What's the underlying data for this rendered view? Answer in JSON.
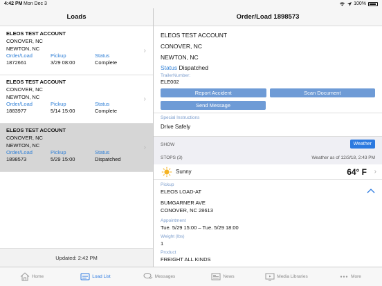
{
  "status_bar": {
    "time": "4:42 PM",
    "date": "Mon Dec 3",
    "battery": "100%"
  },
  "left_header": {
    "title": "Loads"
  },
  "right_header": {
    "title": "Order/Load 1898573"
  },
  "loads": [
    {
      "account": "ELEOS TEST ACCOUNT",
      "city1": "CONOVER, NC",
      "city2": "NEWTON, NC",
      "order_label": "Order/Load",
      "order": "1872661",
      "pickup_label": "Pickup",
      "pickup": "3/29 08:00",
      "status_label": "Status",
      "status": "Complete",
      "selected": false
    },
    {
      "account": "ELEOS TEST ACCOUNT",
      "city1": "CONOVER, NC",
      "city2": "NEWTON, NC",
      "order_label": "Order/Load",
      "order": "1883977",
      "pickup_label": "Pickup",
      "pickup": "5/14 15:00",
      "status_label": "Status",
      "status": "Complete",
      "selected": false
    },
    {
      "account": "ELEOS TEST ACCOUNT",
      "city1": "CONOVER, NC",
      "city2": "NEWTON, NC",
      "order_label": "Order/Load",
      "order": "1898573",
      "pickup_label": "Pickup",
      "pickup": "5/29 15:00",
      "status_label": "Status",
      "status": "Dispatched",
      "selected": true
    }
  ],
  "updated": "Updated: 2:42 PM",
  "detail": {
    "account": "ELEOS TEST ACCOUNT",
    "city1": "CONOVER, NC",
    "city2": "NEWTON, NC",
    "status_label": "Status",
    "status": "Dispatched",
    "trailer_label": "TrailerNumber:",
    "trailer": "ELE002",
    "buttons": {
      "report": "Report Accident",
      "scan": "Scan Document",
      "message": "Send Message"
    },
    "special_label": "Special Instructions",
    "special": "Drive Safely",
    "show_label": "SHOW",
    "weather_button": "Weather",
    "stops_label": "STOPS (3)",
    "weather_as_of": "Weather as of 12/3/18, 2:43 PM",
    "weather_cond": "Sunny",
    "weather_temp": "64° F",
    "stop": {
      "pickup_label": "Pickup",
      "name": "ELEOS LOAD-AT",
      "street": "BUMGARNER AVE",
      "city": "CONOVER, NC 28613",
      "appt_label": "Appointment",
      "appt": "Tue. 5/29 15:00 – Tue. 5/29 18:00",
      "weight_label": "Weight (lbs)",
      "weight": "1",
      "product_label": "Product",
      "product": "FREIGHT ALL KINDS"
    }
  },
  "tabs": [
    {
      "label": "Home",
      "icon": "home-icon",
      "active": false
    },
    {
      "label": "Load List",
      "icon": "truck-icon",
      "active": true
    },
    {
      "label": "Messages",
      "icon": "messages-icon",
      "active": false
    },
    {
      "label": "News",
      "icon": "news-icon",
      "active": false
    },
    {
      "label": "Media Libraries",
      "icon": "media-icon",
      "active": false
    },
    {
      "label": "More",
      "icon": "more-icon",
      "active": false
    }
  ],
  "colors": {
    "accent": "#2c7ae0",
    "button": "#6e9bd6",
    "label_blue": "#2f7fd6",
    "selected_row": "#d6d6d6"
  }
}
